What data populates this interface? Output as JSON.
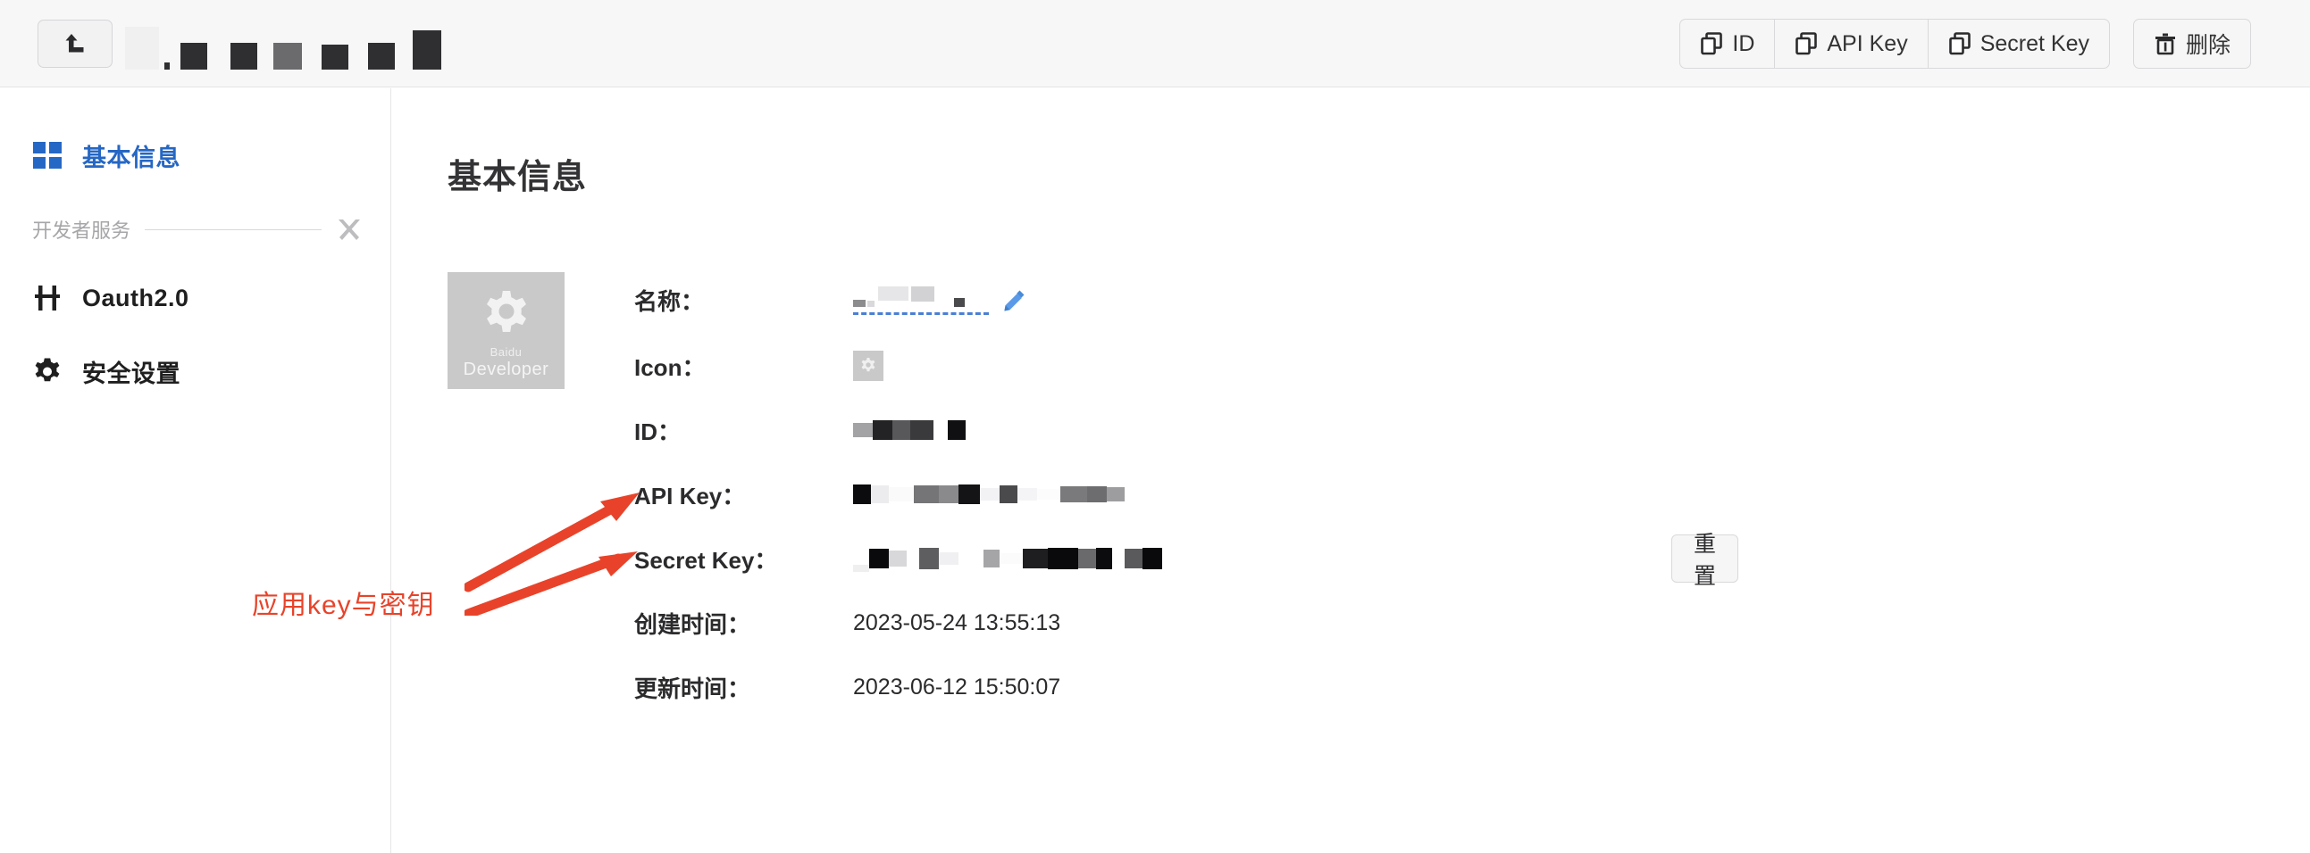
{
  "header": {
    "back_button": {
      "name": "back-button",
      "icon": "back-arrow-icon"
    },
    "app_title_redacted": "",
    "actions": {
      "copy_id_label": "ID",
      "copy_api_key_label": "API Key",
      "copy_secret_key_label": "Secret Key",
      "delete_label": "删除"
    }
  },
  "sidebar": {
    "items": [
      {
        "label": "基本信息",
        "icon": "grid-icon",
        "active": true
      },
      {
        "label": "Oauth2.0",
        "icon": "oauth-icon",
        "active": false
      },
      {
        "label": "安全设置",
        "icon": "gear-icon",
        "active": false
      }
    ],
    "section": {
      "label": "开发者服务",
      "icon": "tools-icon"
    }
  },
  "main": {
    "page_title": "基本信息",
    "app_thumb": {
      "line1": "Baidu",
      "line2": "Developer"
    },
    "fields": [
      {
        "label": "名称：",
        "value": "",
        "redacted": true,
        "editable": true
      },
      {
        "label": "Icon：",
        "value": "",
        "redacted": false,
        "thumb": true
      },
      {
        "label": "ID：",
        "value": "",
        "redacted": true
      },
      {
        "label": "API Key：",
        "value": "",
        "redacted": true
      },
      {
        "label": "Secret Key：",
        "value": "",
        "redacted": true,
        "reset_label": "重置"
      },
      {
        "label": "创建时间：",
        "value": "2023-05-24 13:55:13",
        "redacted": false
      },
      {
        "label": "更新时间：",
        "value": "2023-06-12 15:50:07",
        "redacted": false
      }
    ]
  },
  "annotation": {
    "text": "应用key与密钥",
    "color": "#e8432a"
  },
  "colors": {
    "accent_blue": "#2567c4",
    "annotation_red": "#e8432a",
    "header_bg": "#f7f7f8",
    "border": "#e4e4e6"
  }
}
